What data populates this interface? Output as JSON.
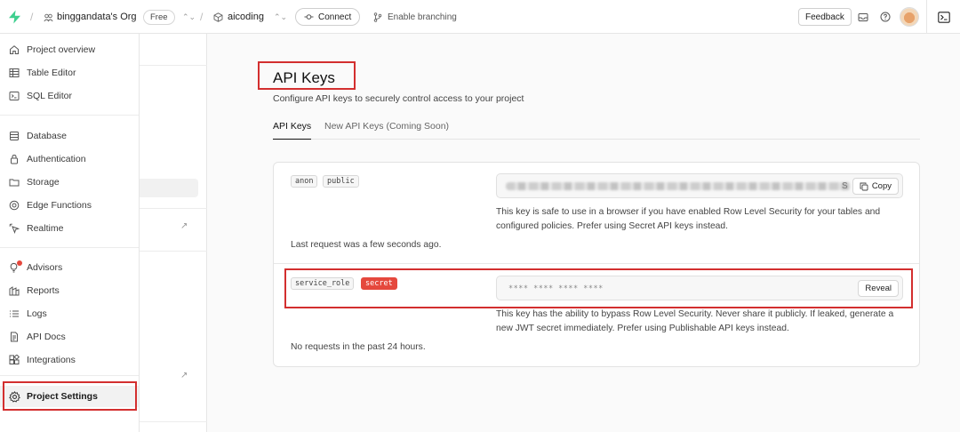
{
  "topbar": {
    "org_name": "binggandata's Org",
    "plan_badge": "Free",
    "project_name": "aicoding",
    "connect_label": "Connect",
    "branching_label": "Enable branching",
    "feedback_label": "Feedback",
    "separator": "/"
  },
  "sidebar": {
    "items": [
      {
        "label": "Project overview",
        "icon": "home-icon"
      },
      {
        "label": "Table Editor",
        "icon": "table-icon"
      },
      {
        "label": "SQL Editor",
        "icon": "terminal-icon"
      },
      {
        "label": "Database",
        "icon": "database-icon"
      },
      {
        "label": "Authentication",
        "icon": "lock-icon"
      },
      {
        "label": "Storage",
        "icon": "folder-icon"
      },
      {
        "label": "Edge Functions",
        "icon": "globe-icon"
      },
      {
        "label": "Realtime",
        "icon": "cursor-icon"
      },
      {
        "label": "Advisors",
        "icon": "lightbulb-icon"
      },
      {
        "label": "Reports",
        "icon": "chart-icon"
      },
      {
        "label": "Logs",
        "icon": "list-icon"
      },
      {
        "label": "API Docs",
        "icon": "document-icon"
      },
      {
        "label": "Integrations",
        "icon": "puzzle-icon"
      },
      {
        "label": "Project Settings",
        "icon": "gear-icon"
      }
    ]
  },
  "main": {
    "title": "API Keys",
    "subtitle": "Configure API keys to securely control access to your project",
    "tabs": [
      {
        "label": "API Keys",
        "active": true
      },
      {
        "label": "New API Keys (Coming Soon)",
        "active": false
      }
    ],
    "keys": [
      {
        "badges": [
          "anon",
          "public"
        ],
        "value_fragment": "S",
        "button": "Copy",
        "description": "This key is safe to use in a browser if you have enabled Row Level Security for your tables and configured policies. Prefer using Secret API keys instead.",
        "footer": "Last request was a few seconds ago."
      },
      {
        "badges": [
          "service_role",
          "secret"
        ],
        "masked_value": "**** **** **** ****",
        "button": "Reveal",
        "description": "This key has the ability to bypass Row Level Security. Never share it publicly. If leaked, generate a new JWT secret immediately. Prefer using Publishable API keys instead.",
        "footer": "No requests in the past 24 hours."
      }
    ]
  },
  "colors": {
    "brand": "#3ecf8e",
    "secret_badge": "#e5483d",
    "highlight": "#d32f2f",
    "notification_dot": "#e5483d"
  }
}
